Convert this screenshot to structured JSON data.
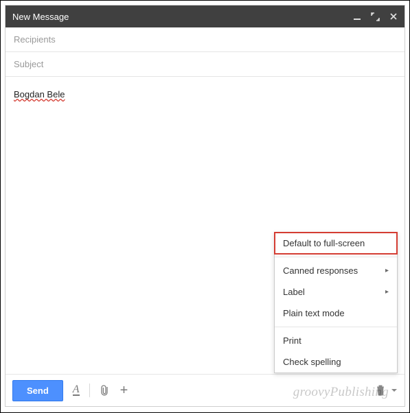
{
  "title": "New Message",
  "fields": {
    "recipients_placeholder": "Recipients",
    "subject_placeholder": "Subject"
  },
  "body": {
    "text": "Bogdan Bele"
  },
  "menu": {
    "default_full_screen": "Default to full-screen",
    "canned_responses": "Canned responses",
    "label": "Label",
    "plain_text_mode": "Plain text mode",
    "print": "Print",
    "check_spelling": "Check spelling"
  },
  "toolbar": {
    "send_label": "Send"
  },
  "watermark": "groovyPublishing"
}
